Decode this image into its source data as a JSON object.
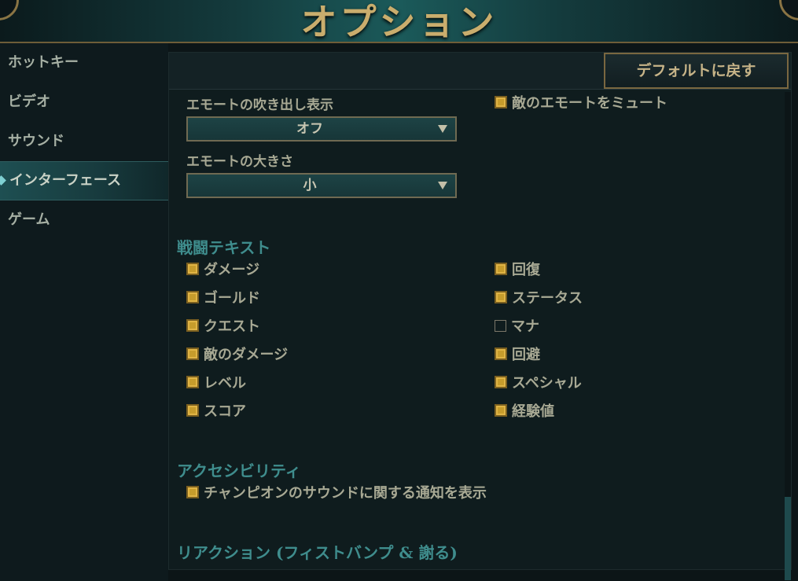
{
  "header": {
    "title": "オプション"
  },
  "sidebar": {
    "items": [
      {
        "label": "ホットキー",
        "active": false
      },
      {
        "label": "ビデオ",
        "active": false
      },
      {
        "label": "サウンド",
        "active": false
      },
      {
        "label": "インターフェース",
        "active": true
      },
      {
        "label": "ゲーム",
        "active": false
      }
    ]
  },
  "toolbar": {
    "reset_label": "デフォルトに戻す"
  },
  "emote": {
    "bubble_label": "エモートの吹き出し表示",
    "bubble_value": "オフ",
    "size_label": "エモートの大きさ",
    "size_value": "小",
    "mute_enemy_label": "敵のエモートをミュート",
    "mute_enemy_checked": true
  },
  "combat_text": {
    "title": "戦闘テキスト",
    "left": [
      {
        "label": "ダメージ",
        "checked": true
      },
      {
        "label": "ゴールド",
        "checked": true
      },
      {
        "label": "クエスト",
        "checked": true
      },
      {
        "label": "敵のダメージ",
        "checked": true
      },
      {
        "label": "レベル",
        "checked": true
      },
      {
        "label": "スコア",
        "checked": true
      }
    ],
    "right": [
      {
        "label": "回復",
        "checked": true
      },
      {
        "label": "ステータス",
        "checked": true
      },
      {
        "label": "マナ",
        "checked": false
      },
      {
        "label": "回避",
        "checked": true
      },
      {
        "label": "スペシャル",
        "checked": true
      },
      {
        "label": "経験値",
        "checked": true
      }
    ]
  },
  "accessibility": {
    "title": "アクセシビリティ",
    "champion_sound_label": "チャンピオンのサウンドに関する通知を表示",
    "champion_sound_checked": true
  },
  "reaction": {
    "title": "リアクション (フィストバンプ & 謝る)"
  },
  "colors": {
    "accent_gold": "#c69c2c",
    "section_teal": "#3f8d8d",
    "header_gold": "#c9ad6d"
  }
}
